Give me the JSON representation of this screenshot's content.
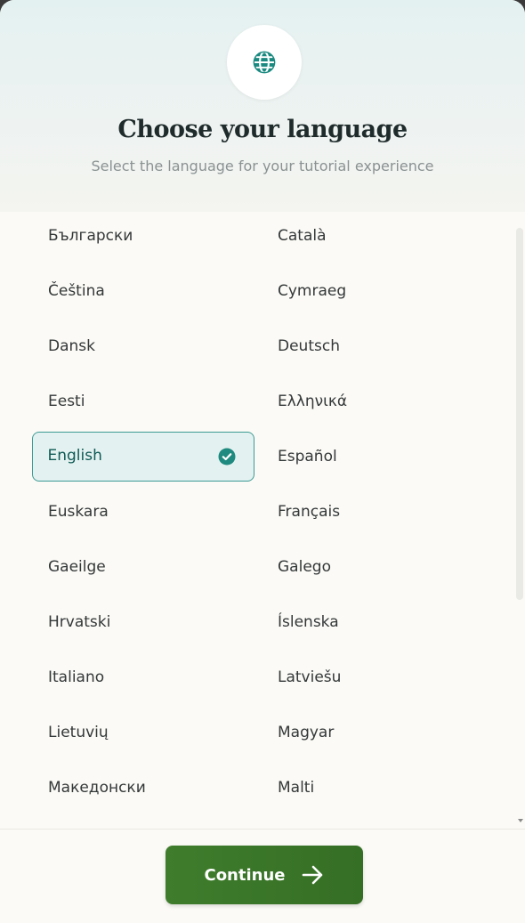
{
  "header": {
    "title": "Choose your language",
    "subtitle": "Select the language for your tutorial experience",
    "icon": "globe-icon"
  },
  "languages": {
    "left": [
      "Български",
      "Čeština",
      "Dansk",
      "Eesti",
      "English",
      "Euskara",
      "Gaeilge",
      "Hrvatski",
      "Italiano",
      "Lietuvių",
      "Македонски"
    ],
    "right": [
      "Català",
      "Cymraeg",
      "Deutsch",
      "Ελληνικά",
      "Español",
      "Français",
      "Galego",
      "Íslenska",
      "Latviešu",
      "Magyar",
      "Malti"
    ]
  },
  "selected_language": "English",
  "continue_button": {
    "label": "Continue",
    "icon": "arrow-right-icon"
  },
  "colors": {
    "accent": "#3d9a93",
    "selected_bg": "#e3f2f1",
    "button_green": "#3f7d2c",
    "header_bg": "#e4f1f1",
    "body_bg": "#fbfaf6"
  }
}
